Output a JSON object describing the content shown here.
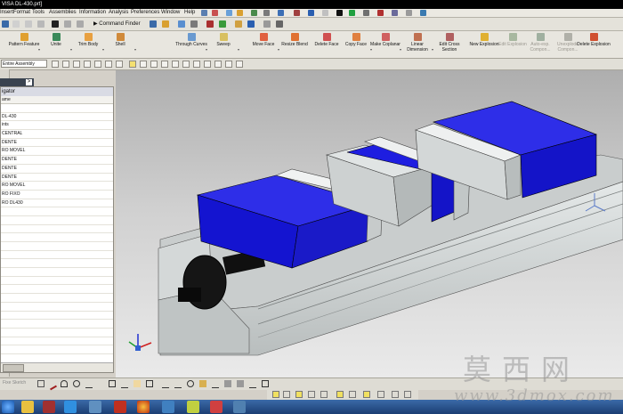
{
  "window": {
    "title": "VISA DL-430.prt]"
  },
  "menu": {
    "items": [
      "Insert",
      "Format",
      "Tools",
      "Assemblies",
      "Information",
      "Analysis",
      "Preferences",
      "Window",
      "Help"
    ]
  },
  "toolbar": {
    "command_finder_label": "Command Finder"
  },
  "ribbon": {
    "buttons": [
      {
        "label": "Pattern Feature",
        "enabled": true
      },
      {
        "label": "Unite",
        "enabled": true
      },
      {
        "label": "Trim Body",
        "enabled": true
      },
      {
        "label": "Shell",
        "enabled": true
      },
      {
        "label": "Through Curves",
        "enabled": true
      },
      {
        "label": "Sweep",
        "enabled": true
      },
      {
        "label": "Move Face",
        "enabled": true
      },
      {
        "label": "Resize Blend",
        "enabled": true
      },
      {
        "label": "Delete Face",
        "enabled": true
      },
      {
        "label": "Copy Face",
        "enabled": true
      },
      {
        "label": "Make Coplanar",
        "enabled": true
      },
      {
        "label": "Linear Dimension",
        "enabled": true
      },
      {
        "label": "Edit Cross Section",
        "enabled": true
      },
      {
        "label": "New Explosion",
        "enabled": true
      },
      {
        "label": "Edit Explosion",
        "enabled": false
      },
      {
        "label": "Auto-exp. Compon...",
        "enabled": false
      },
      {
        "label": "Unexplode Compon...",
        "enabled": false
      },
      {
        "label": "Delete Explosion",
        "enabled": true
      }
    ]
  },
  "selection": {
    "filter_value": "Entire Assembly"
  },
  "navigator": {
    "title": "igator",
    "column_header": "ame",
    "rows": [
      "",
      "DL-430",
      "ints",
      "CENTRAL",
      "DENTE",
      "RO MOVEL",
      "DENTE",
      "DENTE",
      "DENTE",
      "RO MOVEL",
      "RO FIXO",
      "RO DL430",
      "",
      "",
      "",
      "",
      "",
      "",
      "",
      "",
      "",
      "",
      "",
      "",
      "",
      "",
      "",
      "",
      "",
      "",
      "",
      "",
      "",
      ""
    ]
  },
  "bottombar": {
    "label": "Fixe Sketch"
  },
  "watermark": {
    "chinese": "莫西网",
    "url": "www.3dmox.com"
  },
  "colors": {
    "jaw_blue": "#1a1adc",
    "steel_gray": "#cfd3d3",
    "viewport_top": "#aeaeae",
    "viewport_bottom": "#eaeaea"
  }
}
